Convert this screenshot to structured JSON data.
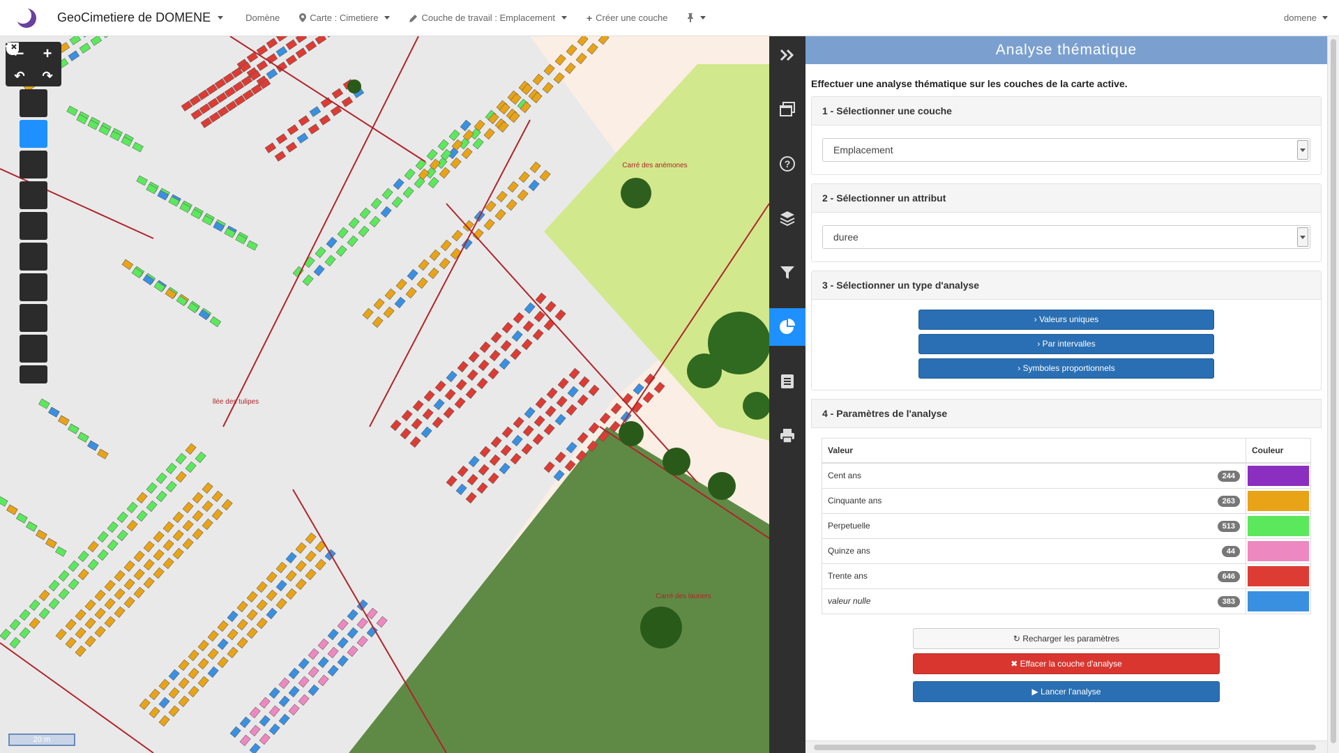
{
  "app": {
    "brand": "GeoCimetiere de DOMENE",
    "nav": {
      "domaine": "Domène",
      "carte": "Carte : Cimetiere",
      "couche": "Couche de travail : Emplacement",
      "creer": "Créer une couche"
    },
    "user": "domene"
  },
  "map": {
    "scale": "20 m",
    "labels": {
      "carre_anemones": "Carré des anémones",
      "carre_lauriers": "Carré des lauriers",
      "allee_tulipes": "llée des tulipes"
    },
    "tools": [
      "globe-icon",
      "select-arrow-icon",
      "pointer-icon",
      "box-select-icon",
      "polygon-select-icon",
      "circle-select-icon",
      "ruler-icon",
      "area-ruler-icon",
      "draw-icon",
      "eraser-icon"
    ]
  },
  "panel": {
    "title": "Analyse thématique",
    "intro": "Effectuer une analyse thématique sur les couches de la carte active.",
    "step1": {
      "title": "1 - Sélectionner une couche",
      "value": "Emplacement"
    },
    "step2": {
      "title": "2 - Sélectionner un attribut",
      "value": "duree"
    },
    "step3": {
      "title": "3 - Sélectionner un type d'analyse",
      "buttons": [
        "Valeurs uniques",
        "Par intervalles",
        "Symboles proportionnels"
      ]
    },
    "step4": {
      "title": "4 - Paramètres de l'analyse",
      "col_value": "Valeur",
      "col_color": "Couleur",
      "rows": [
        {
          "label": "Cent ans",
          "count": "244",
          "color": "#8b2fc0"
        },
        {
          "label": "Cinquante ans",
          "count": "263",
          "color": "#e8a317"
        },
        {
          "label": "Perpetuelle",
          "count": "513",
          "color": "#5ce85c"
        },
        {
          "label": "Quinze ans",
          "count": "44",
          "color": "#ee88c0"
        },
        {
          "label": "Trente ans",
          "count": "646",
          "color": "#dc3c34"
        },
        {
          "label": "valeur nulle",
          "count": "383",
          "color": "#3a90e0"
        }
      ]
    },
    "actions": {
      "reload": "Recharger les paramètres",
      "clear": "Effacer la couche d'analyse",
      "run": "Lancer l'analyse"
    }
  }
}
